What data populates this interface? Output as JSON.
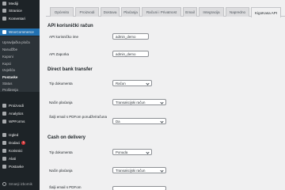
{
  "sidebar": {
    "items": [
      {
        "label": "Mediji",
        "icon": "media-icon"
      },
      {
        "label": "Stranice",
        "icon": "pages-icon"
      },
      {
        "label": "Komentari",
        "icon": "comments-icon"
      },
      {
        "label": "WooCommerce",
        "icon": "woocommerce-icon"
      }
    ],
    "woo_sub": [
      {
        "label": "Upravljačka ploča"
      },
      {
        "label": "Narudžbe"
      },
      {
        "label": "Kuponi"
      },
      {
        "label": "Kupci"
      },
      {
        "label": "Izvješća"
      },
      {
        "label": "Postavke"
      },
      {
        "label": "Status"
      },
      {
        "label": "Proširenja"
      }
    ],
    "items2": [
      {
        "label": "Proizvodi",
        "icon": "products-icon"
      },
      {
        "label": "Analytics",
        "icon": "analytics-icon"
      },
      {
        "label": "WPForms",
        "icon": "wpforms-icon"
      },
      {
        "label": "Izgled",
        "icon": "appearance-icon"
      },
      {
        "label": "Dodaci",
        "icon": "plugins-icon",
        "badge": "1"
      },
      {
        "label": "Korisnici",
        "icon": "users-icon"
      },
      {
        "label": "Alati",
        "icon": "tools-icon"
      },
      {
        "label": "Postavke",
        "icon": "settings-icon"
      }
    ],
    "collapse": "Smanji izbornik"
  },
  "tabs": [
    "Općenito",
    "Proizvodi",
    "Dostava",
    "Plaćanja",
    "Računi i Privatnost",
    "Email",
    "Integracija",
    "Napredno",
    "KigoKasa API"
  ],
  "api_section": {
    "title": "API korisnički račun",
    "username_label": "API korisničko ime",
    "username_value": "admin_demo",
    "password_label": "API Zaporka",
    "password_value": "admin_demo"
  },
  "direct_bank": {
    "title": "Direct bank transfer",
    "doc_type_label": "Tip dokumenta",
    "doc_type_value": "Račun",
    "payment_label": "Način plaćanja",
    "payment_value": "Transakcijski račun",
    "send_email_label": "Šalji email s PDFom porudže/računa",
    "send_email_value": "Da"
  },
  "cash_delivery": {
    "title": "Cash on delivery",
    "doc_type_label": "Tip dokumenta",
    "doc_type_value": "Ponuda",
    "payment_label": "Način plaćanja",
    "payment_value": "Transakcijski račun",
    "send_email_label": "Šalji email s PDFom"
  },
  "colors": {
    "sidebar": "#1d2327",
    "accent": "#2271b1",
    "badge": "#d63638"
  }
}
